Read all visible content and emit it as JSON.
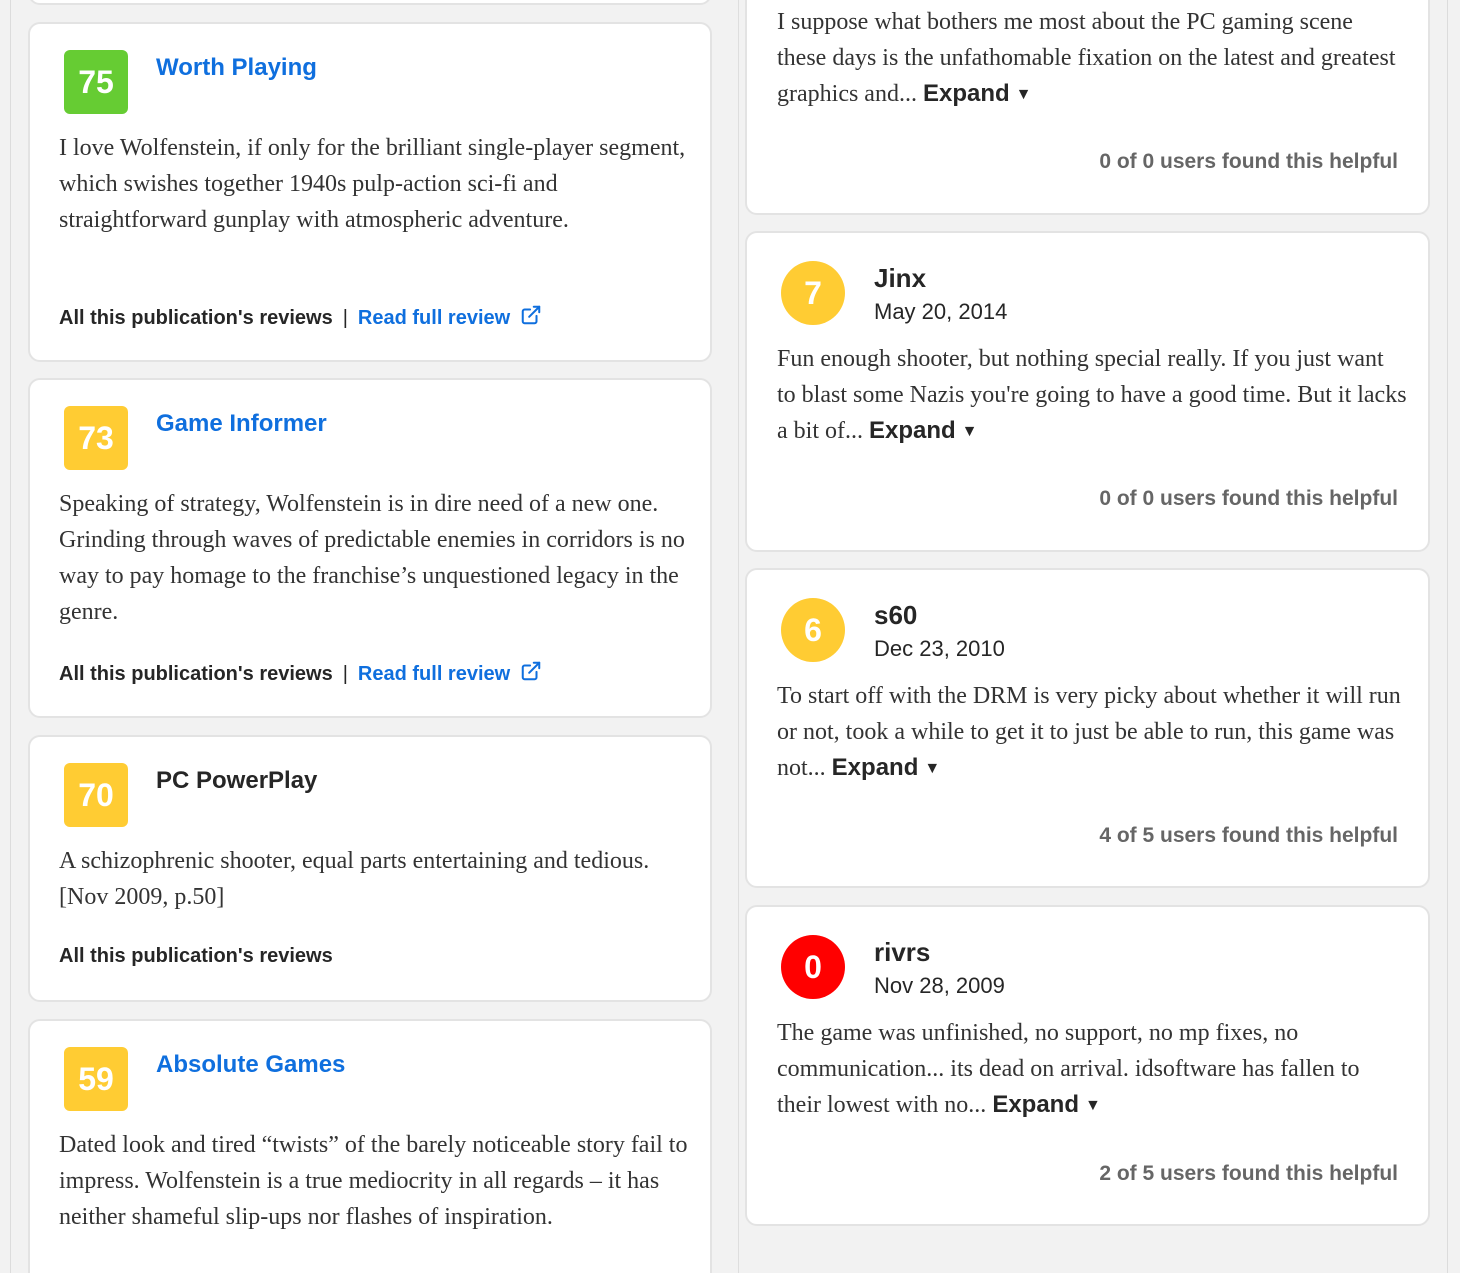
{
  "critic_reviews": [
    {
      "score": "75",
      "publication": "Worth Playing",
      "quote": "I love Wolfenstein, if only for the brilliant single-player segment, which swishes together 1940s pulp-action sci-fi and straightforward gunplay with atmospheric adventure.",
      "all_reviews_label": "All this publication's reviews",
      "separator": "|",
      "read_full_label": "Read full review",
      "color": "#66cc33"
    },
    {
      "score": "73",
      "publication": "Game Informer",
      "quote": "Speaking of strategy, Wolfenstein is in dire need of a new one. Grinding through waves of predictable enemies in corridors is no way to pay homage to the franchise’s unquestioned legacy in the genre.",
      "all_reviews_label": "All this publication's reviews",
      "separator": "|",
      "read_full_label": "Read full review",
      "color": "#ffcc33"
    },
    {
      "score": "70",
      "publication": "PC PowerPlay",
      "quote": "A schizophrenic shooter, equal parts entertaining and tedious. [Nov 2009, p.50]",
      "all_reviews_label": "All this publication's reviews",
      "color": "#ffcc33"
    },
    {
      "score": "59",
      "publication": "Absolute Games",
      "quote": "Dated look and tired “twists” of the barely noticeable story fail to impress. Wolfenstein is a true mediocrity in all regards – it has neither shameful slip-ups nor flashes of inspiration.",
      "color": "#ffcc33"
    }
  ],
  "user_reviews": [
    {
      "quote": "I suppose what bothers me most about the PC gaming scene these days is the unfathomable fixation on the latest and greatest graphics and...",
      "expand_label": "Expand",
      "helpful": "0 of 0 users found this helpful"
    },
    {
      "score": "7",
      "username": "Jinx",
      "date": "May 20, 2014",
      "quote": "Fun enough shooter, but nothing special really. If you just want to blast some Nazis you're going to have a good time. But it lacks a bit of...",
      "expand_label": "Expand",
      "helpful": "0 of 0 users found this helpful",
      "color": "#ffcc33"
    },
    {
      "score": "6",
      "username": "s60",
      "date": "Dec 23, 2010",
      "quote": "To start off with the DRM is very picky about whether it will run or not, took a while to get it to just be able to run, this game was not...",
      "expand_label": "Expand",
      "helpful": "4 of 5 users found this helpful",
      "color": "#ffcc33"
    },
    {
      "score": "0",
      "username": "rivrs",
      "date": "Nov 28, 2009",
      "quote": "The game was unfinished, no support, no mp fixes, no communication... its dead on arrival. idsoftware has fallen to their lowest with no...",
      "expand_label": "Expand",
      "helpful": "2 of 5 users found this helpful",
      "color": "#ff0000"
    }
  ],
  "icons": {
    "external_link": "external-link-icon",
    "expand_caret": "caret-down-icon"
  }
}
